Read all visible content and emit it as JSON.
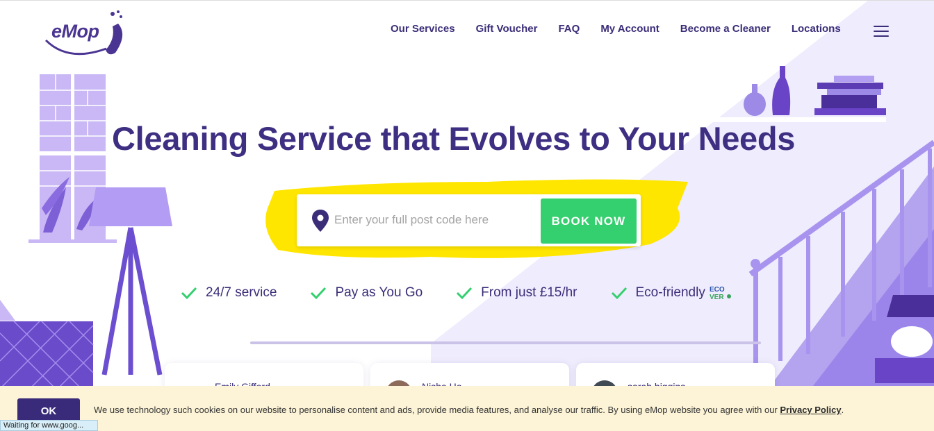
{
  "header": {
    "logo_text": "eMop",
    "nav": [
      "Our Services",
      "Gift Voucher",
      "FAQ",
      "My Account",
      "Become a Cleaner",
      "Locations"
    ]
  },
  "hero": {
    "title": "Cleaning Service that Evolves to Your Needs",
    "postcode_placeholder": "Enter your full post code here",
    "postcode_value": "",
    "book_label": "BOOK NOW"
  },
  "features": [
    "24/7 service",
    "Pay as You Go",
    "From just £15/hr",
    "Eco-friendly"
  ],
  "eco_badge": "ECO VER",
  "reviews": [
    {
      "name": "Emily Gifford"
    },
    {
      "name": "Nisha Ho"
    },
    {
      "name": "sarah higgins"
    }
  ],
  "cookie": {
    "ok_label": "OK",
    "text": "We use technology such cookies on our website to personalise content and ads, provide media features, and analyse our traffic. By using eMop website you agree with our",
    "link_label": "Privacy Policy",
    "suffix": "."
  },
  "status_bar": "Waiting for www.goog...",
  "colors": {
    "brand_purple": "#3f2f82",
    "accent_green": "#34cf6e",
    "highlight_yellow": "#ffe600",
    "lavender": "#e9e4fb",
    "cookie_bg": "#fdf4d7"
  }
}
